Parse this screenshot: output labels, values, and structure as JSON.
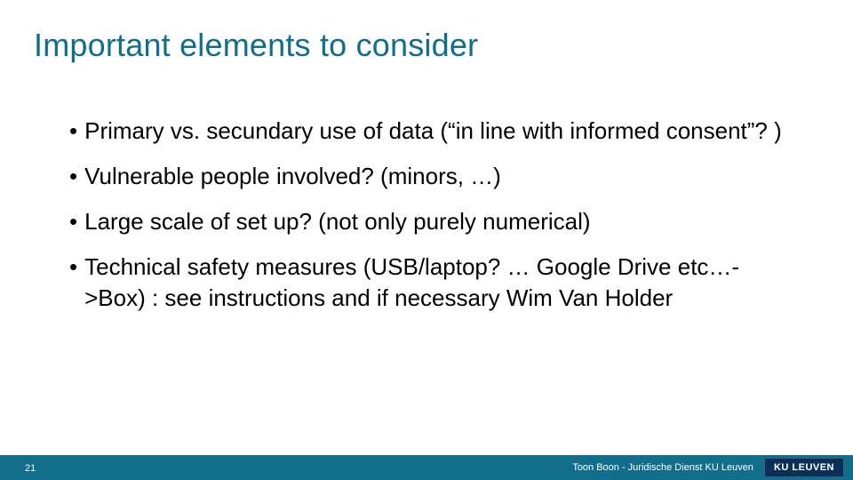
{
  "title": "Important elements to consider",
  "bullets": [
    "Primary vs. secundary use of data (“in line with informed consent”? )",
    "Vulnerable people involved? (minors, …)",
    "Large scale of set up? (not only purely numerical)",
    "Technical safety measures (USB/laptop? … Google Drive etc…->Box) : see instructions and if necessary Wim Van Holder"
  ],
  "footer": {
    "page": "21",
    "text": "Toon Boon - Juridische Dienst KU Leuven",
    "logo": "KU LEUVEN"
  }
}
